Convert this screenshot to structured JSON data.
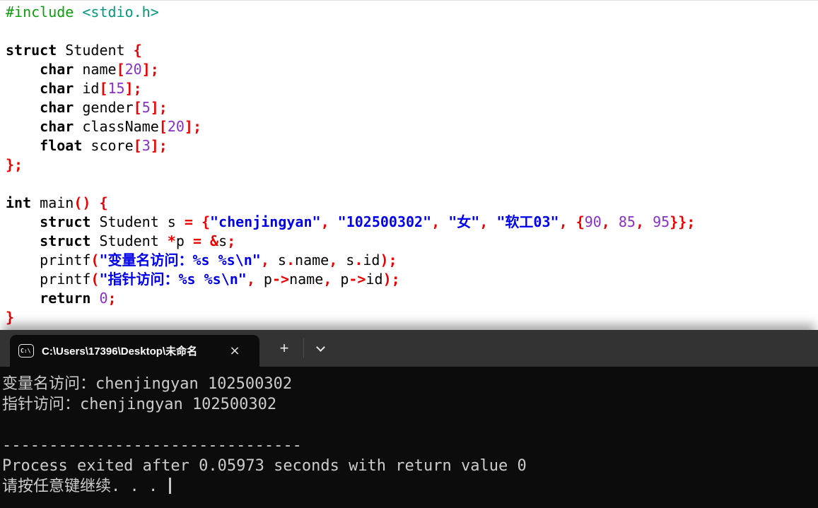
{
  "colors": {
    "editor_background": "#ffffff",
    "keyword": "#000000",
    "symbol_red": "#ee0000",
    "number_purple": "#8b2fc9",
    "string_blue": "#0000ee",
    "preprocessor_green": "#0da00d",
    "include_teal": "#00997d",
    "tab_bar_background": "#333333",
    "terminal_background": "#0c0c0c",
    "terminal_text": "#cccccc"
  },
  "editor": {
    "lines": [
      {
        "segments": [
          {
            "s": "pre",
            "t": "#include "
          },
          {
            "s": "inc",
            "t": "<stdio.h>"
          }
        ]
      },
      {
        "segments": []
      },
      {
        "segments": [
          {
            "s": "kw",
            "t": "struct"
          },
          {
            "s": "id",
            "t": " Student "
          },
          {
            "s": "sym",
            "t": "{"
          }
        ]
      },
      {
        "segments": [
          {
            "s": "id",
            "t": "    "
          },
          {
            "s": "kw",
            "t": "char"
          },
          {
            "s": "id",
            "t": " name"
          },
          {
            "s": "sym",
            "t": "["
          },
          {
            "s": "num",
            "t": "20"
          },
          {
            "s": "sym",
            "t": "];"
          }
        ]
      },
      {
        "segments": [
          {
            "s": "id",
            "t": "    "
          },
          {
            "s": "kw",
            "t": "char"
          },
          {
            "s": "id",
            "t": " id"
          },
          {
            "s": "sym",
            "t": "["
          },
          {
            "s": "num",
            "t": "15"
          },
          {
            "s": "sym",
            "t": "];"
          }
        ]
      },
      {
        "segments": [
          {
            "s": "id",
            "t": "    "
          },
          {
            "s": "kw",
            "t": "char"
          },
          {
            "s": "id",
            "t": " gender"
          },
          {
            "s": "sym",
            "t": "["
          },
          {
            "s": "num",
            "t": "5"
          },
          {
            "s": "sym",
            "t": "];"
          }
        ]
      },
      {
        "segments": [
          {
            "s": "id",
            "t": "    "
          },
          {
            "s": "kw",
            "t": "char"
          },
          {
            "s": "id",
            "t": " className"
          },
          {
            "s": "sym",
            "t": "["
          },
          {
            "s": "num",
            "t": "20"
          },
          {
            "s": "sym",
            "t": "];"
          }
        ]
      },
      {
        "segments": [
          {
            "s": "id",
            "t": "    "
          },
          {
            "s": "kw",
            "t": "float"
          },
          {
            "s": "id",
            "t": " score"
          },
          {
            "s": "sym",
            "t": "["
          },
          {
            "s": "num",
            "t": "3"
          },
          {
            "s": "sym",
            "t": "];"
          }
        ]
      },
      {
        "segments": [
          {
            "s": "sym",
            "t": "};"
          }
        ]
      },
      {
        "segments": []
      },
      {
        "segments": [
          {
            "s": "kw",
            "t": "int"
          },
          {
            "s": "id",
            "t": " main"
          },
          {
            "s": "sym",
            "t": "()"
          },
          {
            "s": "id",
            "t": " "
          },
          {
            "s": "sym",
            "t": "{"
          }
        ]
      },
      {
        "segments": [
          {
            "s": "id",
            "t": "    "
          },
          {
            "s": "kw",
            "t": "struct"
          },
          {
            "s": "id",
            "t": " Student s "
          },
          {
            "s": "sym",
            "t": "="
          },
          {
            "s": "id",
            "t": " "
          },
          {
            "s": "sym",
            "t": "{"
          },
          {
            "s": "str",
            "t": "\"chenjingyan\""
          },
          {
            "s": "sym",
            "t": ","
          },
          {
            "s": "id",
            "t": " "
          },
          {
            "s": "str",
            "t": "\"102500302\""
          },
          {
            "s": "sym",
            "t": ","
          },
          {
            "s": "id",
            "t": " "
          },
          {
            "s": "str",
            "t": "\"女\""
          },
          {
            "s": "sym",
            "t": ","
          },
          {
            "s": "id",
            "t": " "
          },
          {
            "s": "str",
            "t": "\"软工03\""
          },
          {
            "s": "sym",
            "t": ","
          },
          {
            "s": "id",
            "t": " "
          },
          {
            "s": "sym",
            "t": "{"
          },
          {
            "s": "num",
            "t": "90"
          },
          {
            "s": "sym",
            "t": ","
          },
          {
            "s": "id",
            "t": " "
          },
          {
            "s": "num",
            "t": "85"
          },
          {
            "s": "sym",
            "t": ","
          },
          {
            "s": "id",
            "t": " "
          },
          {
            "s": "num",
            "t": "95"
          },
          {
            "s": "sym",
            "t": "}};"
          }
        ]
      },
      {
        "segments": [
          {
            "s": "id",
            "t": "    "
          },
          {
            "s": "kw",
            "t": "struct"
          },
          {
            "s": "id",
            "t": " Student "
          },
          {
            "s": "sym",
            "t": "*"
          },
          {
            "s": "id",
            "t": "p "
          },
          {
            "s": "sym",
            "t": "="
          },
          {
            "s": "id",
            "t": " "
          },
          {
            "s": "sym",
            "t": "&"
          },
          {
            "s": "id",
            "t": "s"
          },
          {
            "s": "sym",
            "t": ";"
          }
        ]
      },
      {
        "segments": [
          {
            "s": "id",
            "t": "    printf"
          },
          {
            "s": "sym",
            "t": "("
          },
          {
            "s": "str",
            "t": "\"变量名访问：%s %s\\n\""
          },
          {
            "s": "sym",
            "t": ","
          },
          {
            "s": "id",
            "t": " s"
          },
          {
            "s": "sym",
            "t": "."
          },
          {
            "s": "id",
            "t": "name"
          },
          {
            "s": "sym",
            "t": ","
          },
          {
            "s": "id",
            "t": " s"
          },
          {
            "s": "sym",
            "t": "."
          },
          {
            "s": "id",
            "t": "id"
          },
          {
            "s": "sym",
            "t": ");"
          }
        ]
      },
      {
        "segments": [
          {
            "s": "id",
            "t": "    printf"
          },
          {
            "s": "sym",
            "t": "("
          },
          {
            "s": "str",
            "t": "\"指针访问：%s %s\\n\""
          },
          {
            "s": "sym",
            "t": ","
          },
          {
            "s": "id",
            "t": " p"
          },
          {
            "s": "sym",
            "t": "->"
          },
          {
            "s": "id",
            "t": "name"
          },
          {
            "s": "sym",
            "t": ","
          },
          {
            "s": "id",
            "t": " p"
          },
          {
            "s": "sym",
            "t": "->"
          },
          {
            "s": "id",
            "t": "id"
          },
          {
            "s": "sym",
            "t": ");"
          }
        ]
      },
      {
        "segments": [
          {
            "s": "id",
            "t": "    "
          },
          {
            "s": "kw",
            "t": "return"
          },
          {
            "s": "id",
            "t": " "
          },
          {
            "s": "num",
            "t": "0"
          },
          {
            "s": "sym",
            "t": ";"
          }
        ]
      },
      {
        "segments": [
          {
            "s": "sym",
            "t": "}"
          }
        ]
      }
    ]
  },
  "terminal": {
    "tab": {
      "title": "C:\\Users\\17396\\Desktop\\未命名",
      "icon_text": "C:\\",
      "close_glyph": "×"
    },
    "new_tab_glyph": "+",
    "output_lines": [
      "变量名访问：chenjingyan 102500302",
      "指针访问：chenjingyan 102500302",
      "",
      "--------------------------------",
      "Process exited after 0.05973 seconds with return value 0",
      "请按任意键继续. . . "
    ]
  }
}
